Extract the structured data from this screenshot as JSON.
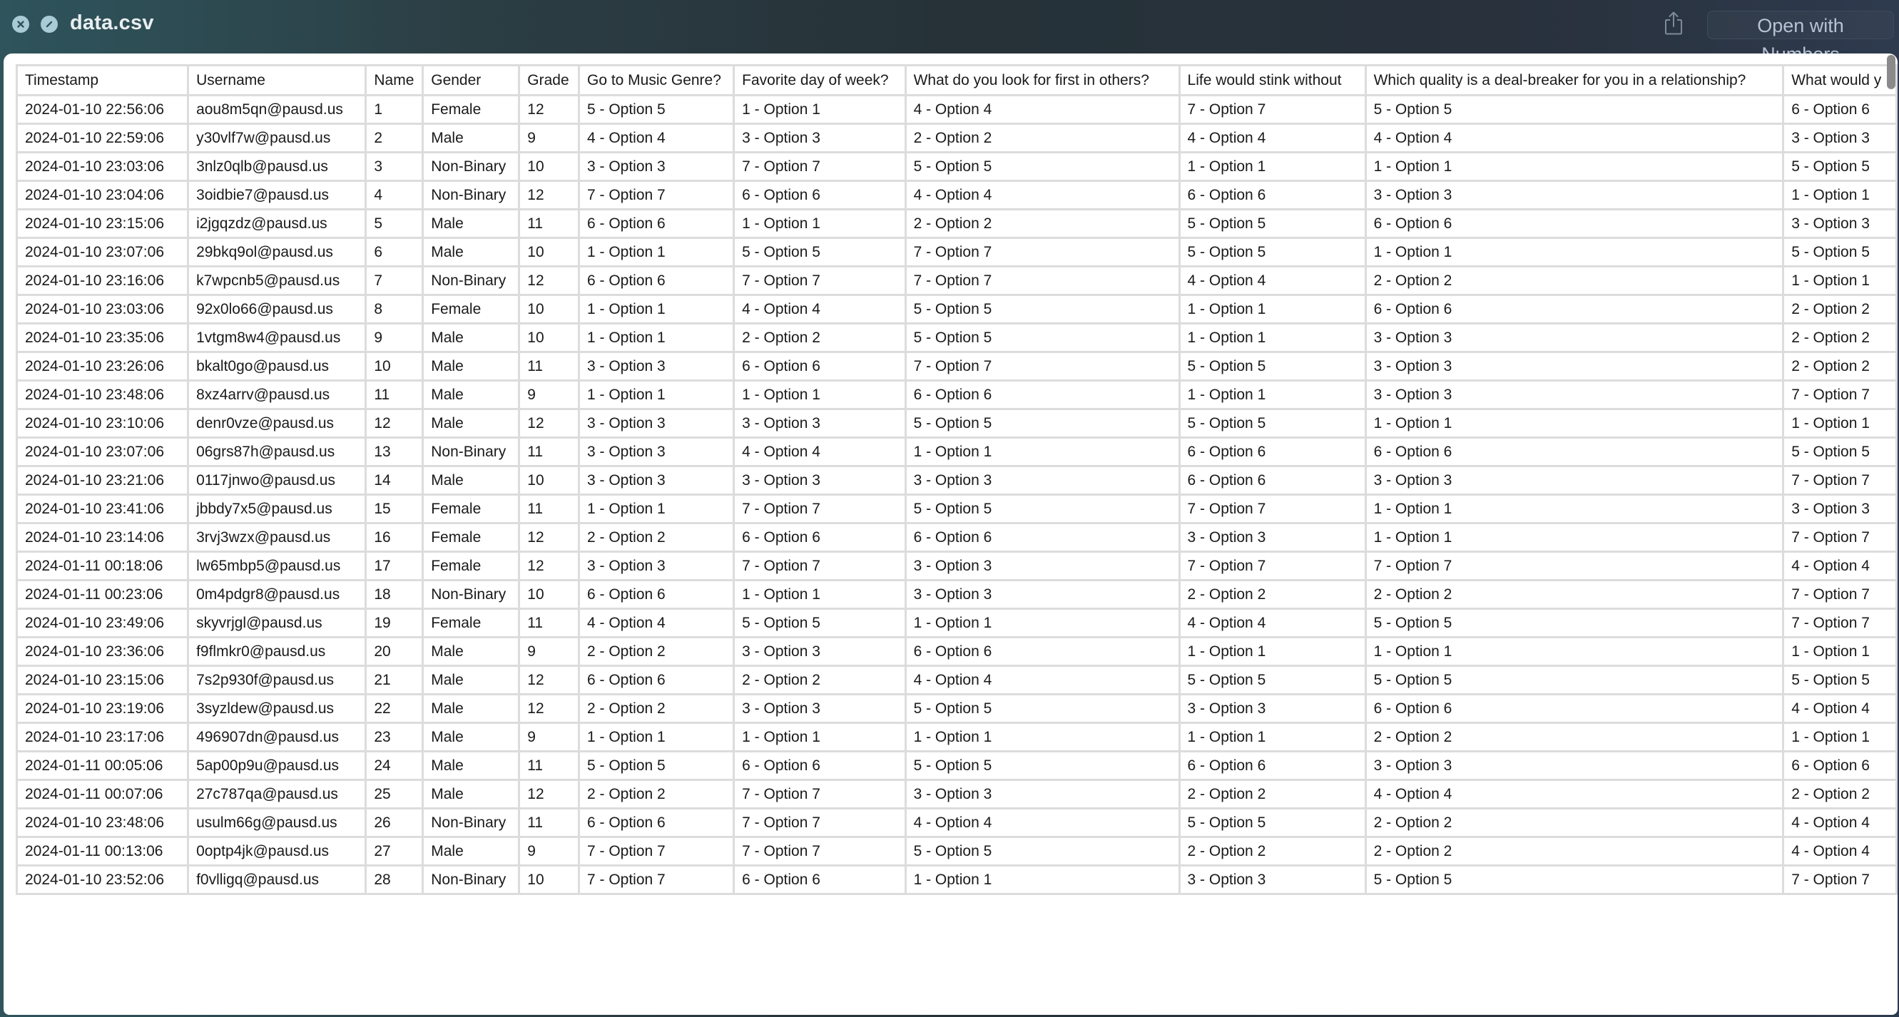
{
  "window": {
    "title": "data.csv",
    "close_icon": "close-circle-icon",
    "fullscreen_icon": "fullscreen-slash-icon",
    "share_icon": "share-icon",
    "open_button_label": "Open with Numbers"
  },
  "table": {
    "headers": [
      "Timestamp",
      "Username",
      "Name",
      "Gender",
      "Grade",
      "Go to Music Genre?",
      "Favorite day of week?",
      "What do you look for first in others?",
      "Life would stink without",
      "Which quality is a deal-breaker for you in a relationship?",
      "What would y"
    ],
    "rows": [
      [
        "2024-01-10 22:56:06",
        "aou8m5qn@pausd.us",
        "1",
        "Female",
        "12",
        "5 - Option 5",
        "1 - Option 1",
        "4 - Option 4",
        "7 - Option 7",
        "5 - Option 5",
        "6 - Option 6"
      ],
      [
        "2024-01-10 22:59:06",
        "y30vlf7w@pausd.us",
        "2",
        "Male",
        "9",
        "4 - Option 4",
        "3 - Option 3",
        "2 - Option 2",
        "4 - Option 4",
        "4 - Option 4",
        "3 - Option 3"
      ],
      [
        "2024-01-10 23:03:06",
        "3nlz0qlb@pausd.us",
        "3",
        "Non-Binary",
        "10",
        "3 - Option 3",
        "7 - Option 7",
        "5 - Option 5",
        "1 - Option 1",
        "1 - Option 1",
        "5 - Option 5"
      ],
      [
        "2024-01-10 23:04:06",
        "3oidbie7@pausd.us",
        "4",
        "Non-Binary",
        "12",
        "7 - Option 7",
        "6 - Option 6",
        "4 - Option 4",
        "6 - Option 6",
        "3 - Option 3",
        "1 - Option 1"
      ],
      [
        "2024-01-10 23:15:06",
        "i2jgqzdz@pausd.us",
        "5",
        "Male",
        "11",
        "6 - Option 6",
        "1 - Option 1",
        "2 - Option 2",
        "5 - Option 5",
        "6 - Option 6",
        "3 - Option 3"
      ],
      [
        "2024-01-10 23:07:06",
        "29bkq9ol@pausd.us",
        "6",
        "Male",
        "10",
        "1 - Option 1",
        "5 - Option 5",
        "7 - Option 7",
        "5 - Option 5",
        "1 - Option 1",
        "5 - Option 5"
      ],
      [
        "2024-01-10 23:16:06",
        "k7wpcnb5@pausd.us",
        "7",
        "Non-Binary",
        "12",
        "6 - Option 6",
        "7 - Option 7",
        "7 - Option 7",
        "4 - Option 4",
        "2 - Option 2",
        "1 - Option 1"
      ],
      [
        "2024-01-10 23:03:06",
        "92x0lo66@pausd.us",
        "8",
        "Female",
        "10",
        "1 - Option 1",
        "4 - Option 4",
        "5 - Option 5",
        "1 - Option 1",
        "6 - Option 6",
        "2 - Option 2"
      ],
      [
        "2024-01-10 23:35:06",
        "1vtgm8w4@pausd.us",
        "9",
        "Male",
        "10",
        "1 - Option 1",
        "2 - Option 2",
        "5 - Option 5",
        "1 - Option 1",
        "3 - Option 3",
        "2 - Option 2"
      ],
      [
        "2024-01-10 23:26:06",
        "bkalt0go@pausd.us",
        "10",
        "Male",
        "11",
        "3 - Option 3",
        "6 - Option 6",
        "7 - Option 7",
        "5 - Option 5",
        "3 - Option 3",
        "2 - Option 2"
      ],
      [
        "2024-01-10 23:48:06",
        "8xz4arrv@pausd.us",
        "11",
        "Male",
        "9",
        "1 - Option 1",
        "1 - Option 1",
        "6 - Option 6",
        "1 - Option 1",
        "3 - Option 3",
        "7 - Option 7"
      ],
      [
        "2024-01-10 23:10:06",
        "denr0vze@pausd.us",
        "12",
        "Male",
        "12",
        "3 - Option 3",
        "3 - Option 3",
        "5 - Option 5",
        "5 - Option 5",
        "1 - Option 1",
        "1 - Option 1"
      ],
      [
        "2024-01-10 23:07:06",
        "06grs87h@pausd.us",
        "13",
        "Non-Binary",
        "11",
        "3 - Option 3",
        "4 - Option 4",
        "1 - Option 1",
        "6 - Option 6",
        "6 - Option 6",
        "5 - Option 5"
      ],
      [
        "2024-01-10 23:21:06",
        "0117jnwo@pausd.us",
        "14",
        "Male",
        "10",
        "3 - Option 3",
        "3 - Option 3",
        "3 - Option 3",
        "6 - Option 6",
        "3 - Option 3",
        "7 - Option 7"
      ],
      [
        "2024-01-10 23:41:06",
        "jbbdy7x5@pausd.us",
        "15",
        "Female",
        "11",
        "1 - Option 1",
        "7 - Option 7",
        "5 - Option 5",
        "7 - Option 7",
        "1 - Option 1",
        "3 - Option 3"
      ],
      [
        "2024-01-10 23:14:06",
        "3rvj3wzx@pausd.us",
        "16",
        "Female",
        "12",
        "2 - Option 2",
        "6 - Option 6",
        "6 - Option 6",
        "3 - Option 3",
        "1 - Option 1",
        "7 - Option 7"
      ],
      [
        "2024-01-11 00:18:06",
        "lw65mbp5@pausd.us",
        "17",
        "Female",
        "12",
        "3 - Option 3",
        "7 - Option 7",
        "3 - Option 3",
        "7 - Option 7",
        "7 - Option 7",
        "4 - Option 4"
      ],
      [
        "2024-01-11 00:23:06",
        "0m4pdgr8@pausd.us",
        "18",
        "Non-Binary",
        "10",
        "6 - Option 6",
        "1 - Option 1",
        "3 - Option 3",
        "2 - Option 2",
        "2 - Option 2",
        "7 - Option 7"
      ],
      [
        "2024-01-10 23:49:06",
        "skyvrjgl@pausd.us",
        "19",
        "Female",
        "11",
        "4 - Option 4",
        "5 - Option 5",
        "1 - Option 1",
        "4 - Option 4",
        "5 - Option 5",
        "7 - Option 7"
      ],
      [
        "2024-01-10 23:36:06",
        "f9flmkr0@pausd.us",
        "20",
        "Male",
        "9",
        "2 - Option 2",
        "3 - Option 3",
        "6 - Option 6",
        "1 - Option 1",
        "1 - Option 1",
        "1 - Option 1"
      ],
      [
        "2024-01-10 23:15:06",
        "7s2p930f@pausd.us",
        "21",
        "Male",
        "12",
        "6 - Option 6",
        "2 - Option 2",
        "4 - Option 4",
        "5 - Option 5",
        "5 - Option 5",
        "5 - Option 5"
      ],
      [
        "2024-01-10 23:19:06",
        "3syzldew@pausd.us",
        "22",
        "Male",
        "12",
        "2 - Option 2",
        "3 - Option 3",
        "5 - Option 5",
        "3 - Option 3",
        "6 - Option 6",
        "4 - Option 4"
      ],
      [
        "2024-01-10 23:17:06",
        "496907dn@pausd.us",
        "23",
        "Male",
        "9",
        "1 - Option 1",
        "1 - Option 1",
        "1 - Option 1",
        "1 - Option 1",
        "2 - Option 2",
        "1 - Option 1"
      ],
      [
        "2024-01-11 00:05:06",
        "5ap00p9u@pausd.us",
        "24",
        "Male",
        "11",
        "5 - Option 5",
        "6 - Option 6",
        "5 - Option 5",
        "6 - Option 6",
        "3 - Option 3",
        "6 - Option 6"
      ],
      [
        "2024-01-11 00:07:06",
        "27c787qa@pausd.us",
        "25",
        "Male",
        "12",
        "2 - Option 2",
        "7 - Option 7",
        "3 - Option 3",
        "2 - Option 2",
        "4 - Option 4",
        "2 - Option 2"
      ],
      [
        "2024-01-10 23:48:06",
        "usulm66g@pausd.us",
        "26",
        "Non-Binary",
        "11",
        "6 - Option 6",
        "7 - Option 7",
        "4 - Option 4",
        "5 - Option 5",
        "2 - Option 2",
        "4 - Option 4"
      ],
      [
        "2024-01-11 00:13:06",
        "0optp4jk@pausd.us",
        "27",
        "Male",
        "9",
        "7 - Option 7",
        "7 - Option 7",
        "5 - Option 5",
        "2 - Option 2",
        "2 - Option 2",
        "4 - Option 4"
      ],
      [
        "2024-01-10 23:52:06",
        "f0vlligq@pausd.us",
        "28",
        "Non-Binary",
        "10",
        "7 - Option 7",
        "6 - Option 6",
        "1 - Option 1",
        "3 - Option 3",
        "5 - Option 5",
        "7 - Option 7"
      ]
    ]
  }
}
